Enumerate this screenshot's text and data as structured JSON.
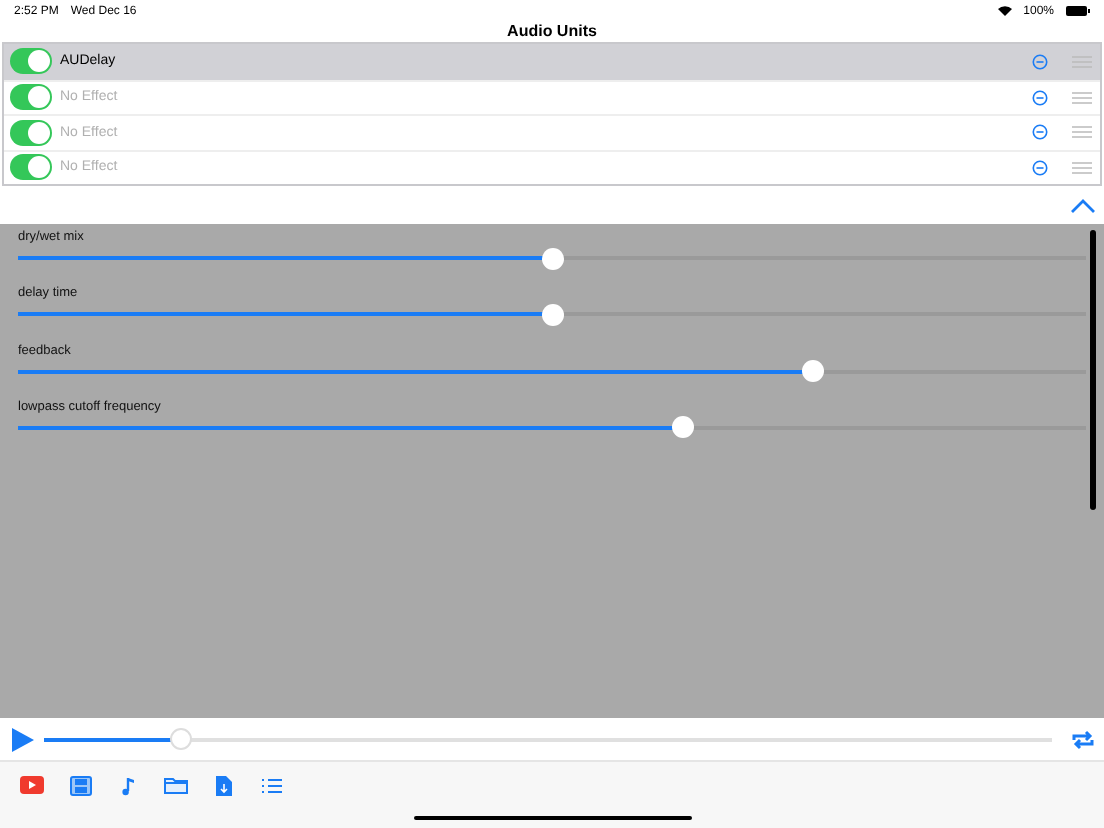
{
  "status_bar": {
    "time": "2:52 PM",
    "date": "Wed Dec 16",
    "battery": "100%"
  },
  "title": "Audio Units",
  "units": [
    {
      "name": "AUDelay",
      "on": true,
      "selected": true,
      "loaded": true
    },
    {
      "name": "No Effect",
      "on": true,
      "selected": false,
      "loaded": false
    },
    {
      "name": "No Effect",
      "on": true,
      "selected": false,
      "loaded": false
    },
    {
      "name": "No Effect",
      "on": true,
      "selected": false,
      "loaded": false
    }
  ],
  "parameters": [
    {
      "label": "dry/wet mix",
      "level": 0.5
    },
    {
      "label": "delay time",
      "level": 0.5
    },
    {
      "label": "feedback",
      "level": 0.745
    },
    {
      "label": "lowpass cutoff frequency",
      "level": 0.623
    }
  ],
  "transport": {
    "level": 0.135
  }
}
